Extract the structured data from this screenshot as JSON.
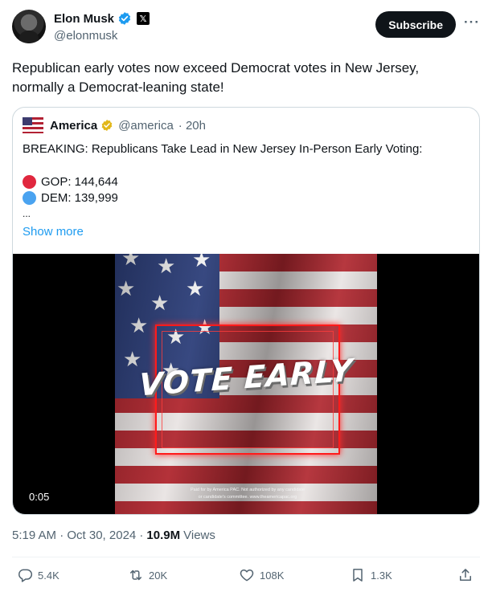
{
  "author": {
    "name": "Elon Musk",
    "handle": "@elonmusk"
  },
  "header": {
    "subscribe_label": "Subscribe",
    "more_label": "···"
  },
  "tweet": {
    "text": "Republican early votes now exceed Democrat votes in New Jersey, normally a Democrat-leaning state!"
  },
  "quote": {
    "name": "America",
    "handle": "@america",
    "time": "· 20h",
    "text": "BREAKING: Republicans Take Lead in New Jersey In-Person Early Voting:",
    "stats": [
      {
        "label": "GOP: 144,644",
        "color": "#e0273e"
      },
      {
        "label": "DEM: 139,999",
        "color": "#4aa3f0"
      }
    ],
    "ellipsis": "...",
    "show_more": "Show more",
    "video": {
      "headline": "VOTE EARLY",
      "disclaimer_line1": "Paid for by America PAC. Not authorized by any candidate",
      "disclaimer_line2": "or candidate's committee. www.theamericapac.org",
      "duration": "0:05"
    }
  },
  "meta": {
    "timestamp": "5:19 AM · Oct 30, 2024 ·",
    "views_count": "10.9M",
    "views_label": "Views"
  },
  "actions": {
    "replies": "5.4K",
    "reposts": "20K",
    "likes": "108K",
    "bookmarks": "1.3K"
  },
  "colors": {
    "accent": "#1d9bf0",
    "verified_blue": "#1d9bf0",
    "verified_gold": "#e2b719",
    "text_primary": "#0f1419",
    "text_secondary": "#536471"
  }
}
